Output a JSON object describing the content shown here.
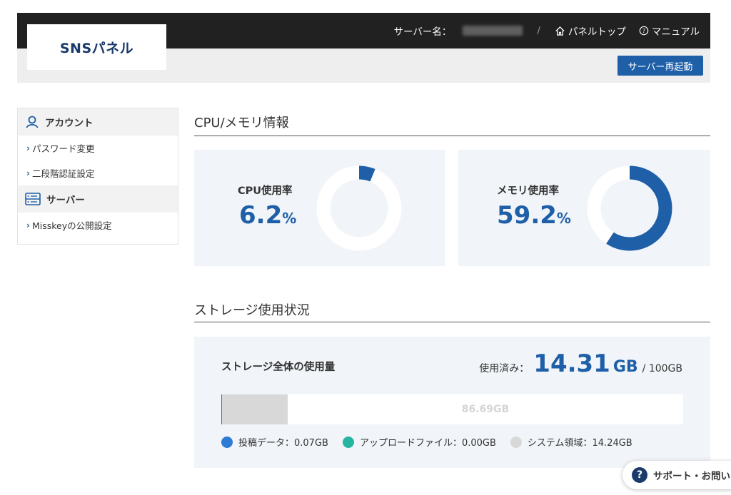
{
  "header": {
    "logo": "SNSパネル",
    "server_label": "サーバー名：",
    "separator": "/",
    "panel_top": "パネルトップ",
    "manual": "マニュアル",
    "restart_button": "サーバー再起動"
  },
  "sidebar": {
    "sections": [
      {
        "heading": "アカウント",
        "icon": "user-icon",
        "items": [
          "パスワード変更",
          "二段階認証設定"
        ]
      },
      {
        "heading": "サーバー",
        "icon": "server-icon",
        "items": [
          "Misskeyの公開設定"
        ]
      }
    ]
  },
  "cpu_mem": {
    "section_title": "CPU/メモリ情報",
    "cpu": {
      "label": "CPU使用率",
      "value": "6.2",
      "unit": "%",
      "percent": 6.2
    },
    "memory": {
      "label": "メモリ使用率",
      "value": "59.2",
      "unit": "%",
      "percent": 59.2
    }
  },
  "storage": {
    "section_title": "ストレージ使用状況",
    "overall_label": "ストレージ全体の使用量",
    "used_label": "使用済み：",
    "used_value": "14.31",
    "used_unit": "GB",
    "total": "/ 100GB",
    "free_label": "86.69GB",
    "used_fraction": 0.1431,
    "post_fraction": 0.0007,
    "legend": [
      {
        "label": "投稿データ：0.07GB",
        "color": "#2e7bd6"
      },
      {
        "label": "アップロードファイル：0.00GB",
        "color": "#26b5a0"
      },
      {
        "label": "システム領域：14.24GB",
        "color": "#d8d8d8"
      }
    ]
  },
  "support": {
    "label": "サポート・お問い"
  },
  "colors": {
    "accent": "#1e5fa8",
    "donut_track": "#ffffff",
    "header_bg": "#212121"
  }
}
